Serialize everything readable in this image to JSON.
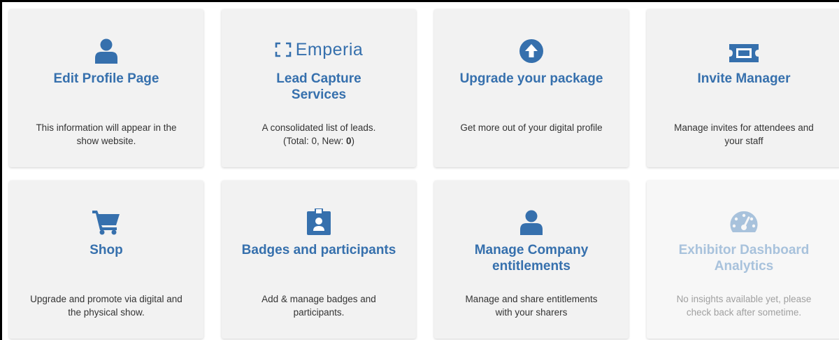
{
  "colors": {
    "accent": "#3670ad",
    "accent_disabled": "#a8c2dc",
    "card_bg": "#f2f2f2"
  },
  "cards": [
    {
      "icon": "person-icon",
      "title": "Edit Profile Page",
      "desc_line1": "This information will appear in the",
      "desc_line2": "show website."
    },
    {
      "icon": "emperia-logo",
      "logo_text": "Emperia",
      "title_line1": "Lead Capture",
      "title_line2": "Services",
      "desc_line1": "A consolidated list of leads.",
      "desc_prefix": "(Total: 0, New: ",
      "desc_new": "0",
      "desc_suffix": ")"
    },
    {
      "icon": "arrow-up-circle-icon",
      "title": "Upgrade your package",
      "desc_line1": "Get more out of your digital profile"
    },
    {
      "icon": "ticket-icon",
      "title": "Invite Manager",
      "desc_line1": "Manage invites for attendees and",
      "desc_line2": "your staff"
    },
    {
      "icon": "shopping-cart-icon",
      "title": "Shop",
      "desc_line1": "Upgrade and promote via digital and",
      "desc_line2": "the physical show."
    },
    {
      "icon": "id-badge-icon",
      "title": "Badges and participants",
      "desc_line1": "Add & manage badges and",
      "desc_line2": "participants."
    },
    {
      "icon": "person-icon",
      "title_line1": "Manage Company",
      "title_line2": "entitlements",
      "desc_line1": "Manage and share entitlements",
      "desc_line2": "with your sharers"
    },
    {
      "icon": "gauge-icon",
      "title_line1": "Exhibitor Dashboard",
      "title_line2": "Analytics",
      "desc_line1": "No insights available yet, please",
      "desc_line2": "check back after sometime.",
      "disabled": true
    }
  ]
}
